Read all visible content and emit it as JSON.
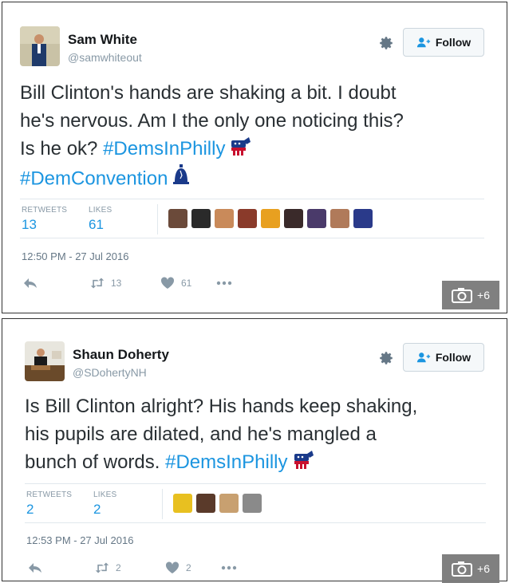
{
  "tweets": [
    {
      "user": {
        "name": "Sam White",
        "handle": "@samwhiteout"
      },
      "follow_label": "Follow",
      "text_lines": [
        "Bill Clinton's hands are shaking a bit. I doubt",
        "he's nervous. Am I the only one noticing this?",
        "Is he ok?"
      ],
      "hashtags": [
        "#DemsInPhilly",
        "#DemConvention"
      ],
      "stats": {
        "retweets_label": "RETWEETS",
        "retweets": "13",
        "likes_label": "LIKES",
        "likes": "61"
      },
      "timestamp": "12:50 PM - 27 Jul 2016",
      "actions": {
        "retweet_count": "13",
        "like_count": "61"
      },
      "photo_badge": "+6",
      "faces_colors": [
        "#6b4a3a",
        "#2a2a2a",
        "#c98a5a",
        "#8a3a2a",
        "#e8a020",
        "#3a2a2a",
        "#4a3a6a",
        "#b07a5a",
        "#2a3a8a"
      ]
    },
    {
      "user": {
        "name": "Shaun Doherty",
        "handle": "@SDohertyNH"
      },
      "follow_label": "Follow",
      "text_lines": [
        "Is Bill Clinton alright? His hands keep shaking,",
        "his pupils are dilated, and he's mangled a",
        "bunch of words."
      ],
      "hashtags": [
        "#DemsInPhilly"
      ],
      "stats": {
        "retweets_label": "RETWEETS",
        "retweets": "2",
        "likes_label": "LIKES",
        "likes": "2"
      },
      "timestamp": "12:53 PM - 27 Jul 2016",
      "actions": {
        "retweet_count": "2",
        "like_count": "2"
      },
      "photo_badge": "+6",
      "faces_colors": [
        "#e8c020",
        "#5a3a2a",
        "#c8a070",
        "#8a8a8a"
      ]
    }
  ],
  "colors": {
    "link": "#1b95e0",
    "muted": "#8899a6"
  },
  "icons": [
    "gear-icon",
    "follow-person-icon",
    "reply-icon",
    "retweet-icon",
    "heart-icon",
    "more-icon",
    "camera-icon",
    "donkey-emoji",
    "liberty-bell-emoji"
  ]
}
